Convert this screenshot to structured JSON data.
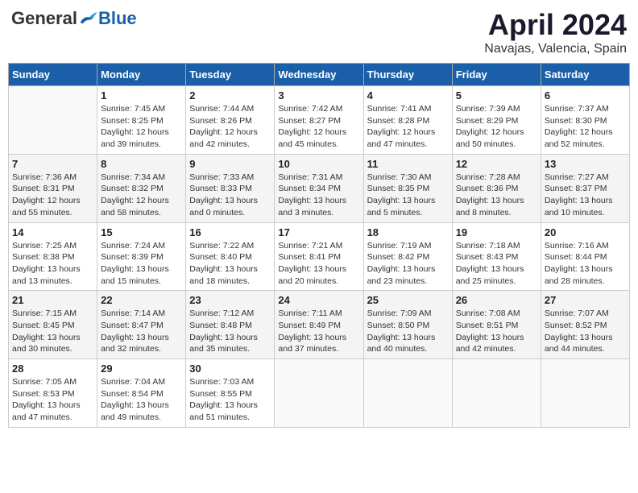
{
  "header": {
    "logo_general": "General",
    "logo_blue": "Blue",
    "month_title": "April 2024",
    "location": "Navajas, Valencia, Spain"
  },
  "weekdays": [
    "Sunday",
    "Monday",
    "Tuesday",
    "Wednesday",
    "Thursday",
    "Friday",
    "Saturday"
  ],
  "weeks": [
    [
      {
        "day": "",
        "sunrise": "",
        "sunset": "",
        "daylight": ""
      },
      {
        "day": "1",
        "sunrise": "Sunrise: 7:45 AM",
        "sunset": "Sunset: 8:25 PM",
        "daylight": "Daylight: 12 hours and 39 minutes."
      },
      {
        "day": "2",
        "sunrise": "Sunrise: 7:44 AM",
        "sunset": "Sunset: 8:26 PM",
        "daylight": "Daylight: 12 hours and 42 minutes."
      },
      {
        "day": "3",
        "sunrise": "Sunrise: 7:42 AM",
        "sunset": "Sunset: 8:27 PM",
        "daylight": "Daylight: 12 hours and 45 minutes."
      },
      {
        "day": "4",
        "sunrise": "Sunrise: 7:41 AM",
        "sunset": "Sunset: 8:28 PM",
        "daylight": "Daylight: 12 hours and 47 minutes."
      },
      {
        "day": "5",
        "sunrise": "Sunrise: 7:39 AM",
        "sunset": "Sunset: 8:29 PM",
        "daylight": "Daylight: 12 hours and 50 minutes."
      },
      {
        "day": "6",
        "sunrise": "Sunrise: 7:37 AM",
        "sunset": "Sunset: 8:30 PM",
        "daylight": "Daylight: 12 hours and 52 minutes."
      }
    ],
    [
      {
        "day": "7",
        "sunrise": "Sunrise: 7:36 AM",
        "sunset": "Sunset: 8:31 PM",
        "daylight": "Daylight: 12 hours and 55 minutes."
      },
      {
        "day": "8",
        "sunrise": "Sunrise: 7:34 AM",
        "sunset": "Sunset: 8:32 PM",
        "daylight": "Daylight: 12 hours and 58 minutes."
      },
      {
        "day": "9",
        "sunrise": "Sunrise: 7:33 AM",
        "sunset": "Sunset: 8:33 PM",
        "daylight": "Daylight: 13 hours and 0 minutes."
      },
      {
        "day": "10",
        "sunrise": "Sunrise: 7:31 AM",
        "sunset": "Sunset: 8:34 PM",
        "daylight": "Daylight: 13 hours and 3 minutes."
      },
      {
        "day": "11",
        "sunrise": "Sunrise: 7:30 AM",
        "sunset": "Sunset: 8:35 PM",
        "daylight": "Daylight: 13 hours and 5 minutes."
      },
      {
        "day": "12",
        "sunrise": "Sunrise: 7:28 AM",
        "sunset": "Sunset: 8:36 PM",
        "daylight": "Daylight: 13 hours and 8 minutes."
      },
      {
        "day": "13",
        "sunrise": "Sunrise: 7:27 AM",
        "sunset": "Sunset: 8:37 PM",
        "daylight": "Daylight: 13 hours and 10 minutes."
      }
    ],
    [
      {
        "day": "14",
        "sunrise": "Sunrise: 7:25 AM",
        "sunset": "Sunset: 8:38 PM",
        "daylight": "Daylight: 13 hours and 13 minutes."
      },
      {
        "day": "15",
        "sunrise": "Sunrise: 7:24 AM",
        "sunset": "Sunset: 8:39 PM",
        "daylight": "Daylight: 13 hours and 15 minutes."
      },
      {
        "day": "16",
        "sunrise": "Sunrise: 7:22 AM",
        "sunset": "Sunset: 8:40 PM",
        "daylight": "Daylight: 13 hours and 18 minutes."
      },
      {
        "day": "17",
        "sunrise": "Sunrise: 7:21 AM",
        "sunset": "Sunset: 8:41 PM",
        "daylight": "Daylight: 13 hours and 20 minutes."
      },
      {
        "day": "18",
        "sunrise": "Sunrise: 7:19 AM",
        "sunset": "Sunset: 8:42 PM",
        "daylight": "Daylight: 13 hours and 23 minutes."
      },
      {
        "day": "19",
        "sunrise": "Sunrise: 7:18 AM",
        "sunset": "Sunset: 8:43 PM",
        "daylight": "Daylight: 13 hours and 25 minutes."
      },
      {
        "day": "20",
        "sunrise": "Sunrise: 7:16 AM",
        "sunset": "Sunset: 8:44 PM",
        "daylight": "Daylight: 13 hours and 28 minutes."
      }
    ],
    [
      {
        "day": "21",
        "sunrise": "Sunrise: 7:15 AM",
        "sunset": "Sunset: 8:45 PM",
        "daylight": "Daylight: 13 hours and 30 minutes."
      },
      {
        "day": "22",
        "sunrise": "Sunrise: 7:14 AM",
        "sunset": "Sunset: 8:47 PM",
        "daylight": "Daylight: 13 hours and 32 minutes."
      },
      {
        "day": "23",
        "sunrise": "Sunrise: 7:12 AM",
        "sunset": "Sunset: 8:48 PM",
        "daylight": "Daylight: 13 hours and 35 minutes."
      },
      {
        "day": "24",
        "sunrise": "Sunrise: 7:11 AM",
        "sunset": "Sunset: 8:49 PM",
        "daylight": "Daylight: 13 hours and 37 minutes."
      },
      {
        "day": "25",
        "sunrise": "Sunrise: 7:09 AM",
        "sunset": "Sunset: 8:50 PM",
        "daylight": "Daylight: 13 hours and 40 minutes."
      },
      {
        "day": "26",
        "sunrise": "Sunrise: 7:08 AM",
        "sunset": "Sunset: 8:51 PM",
        "daylight": "Daylight: 13 hours and 42 minutes."
      },
      {
        "day": "27",
        "sunrise": "Sunrise: 7:07 AM",
        "sunset": "Sunset: 8:52 PM",
        "daylight": "Daylight: 13 hours and 44 minutes."
      }
    ],
    [
      {
        "day": "28",
        "sunrise": "Sunrise: 7:05 AM",
        "sunset": "Sunset: 8:53 PM",
        "daylight": "Daylight: 13 hours and 47 minutes."
      },
      {
        "day": "29",
        "sunrise": "Sunrise: 7:04 AM",
        "sunset": "Sunset: 8:54 PM",
        "daylight": "Daylight: 13 hours and 49 minutes."
      },
      {
        "day": "30",
        "sunrise": "Sunrise: 7:03 AM",
        "sunset": "Sunset: 8:55 PM",
        "daylight": "Daylight: 13 hours and 51 minutes."
      },
      {
        "day": "",
        "sunrise": "",
        "sunset": "",
        "daylight": ""
      },
      {
        "day": "",
        "sunrise": "",
        "sunset": "",
        "daylight": ""
      },
      {
        "day": "",
        "sunrise": "",
        "sunset": "",
        "daylight": ""
      },
      {
        "day": "",
        "sunrise": "",
        "sunset": "",
        "daylight": ""
      }
    ]
  ]
}
